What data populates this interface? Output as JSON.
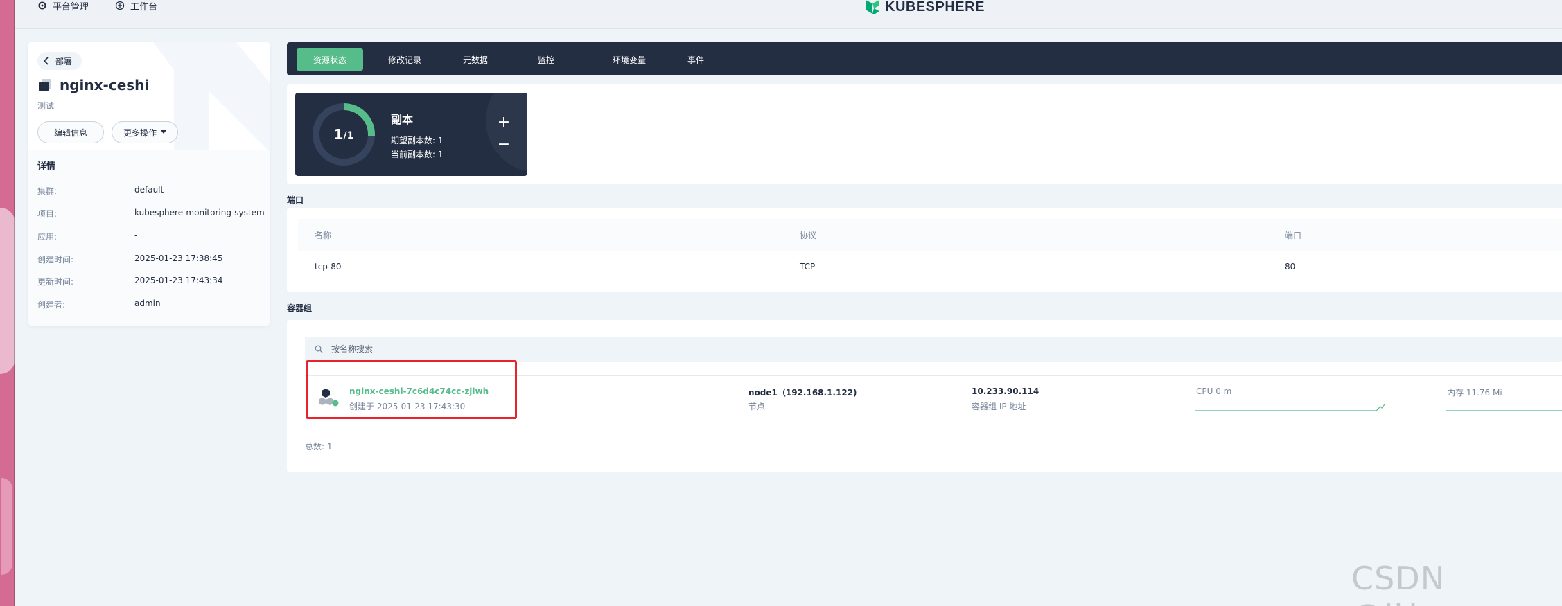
{
  "topbar": {
    "platform_label": "平台管理",
    "workbench_label": "工作台",
    "logo_text": "KUBESPHERE"
  },
  "left": {
    "back_label": "部署",
    "resource_name": "nginx-ceshi",
    "description": "测试",
    "edit_label": "编辑信息",
    "more_label": "更多操作",
    "details_title": "详情",
    "details": [
      {
        "key": "集群:",
        "value": "default"
      },
      {
        "key": "项目:",
        "value": "kubesphere-monitoring-system"
      },
      {
        "key": "应用:",
        "value": "-"
      },
      {
        "key": "创建时间:",
        "value": "2025-01-23 17:38:45"
      },
      {
        "key": "更新时间:",
        "value": "2025-01-23 17:43:34"
      },
      {
        "key": "创建者:",
        "value": "admin"
      }
    ]
  },
  "tabs": [
    "资源状态",
    "修改记录",
    "元数据",
    "监控",
    "环境变量",
    "事件"
  ],
  "replica": {
    "current": "1",
    "total": "/1",
    "ratio": 1,
    "title": "副本",
    "desired_label": "期望副本数: 1",
    "current_label": "当前副本数: 1",
    "plus": "+",
    "minus": "−"
  },
  "ports": {
    "section_title": "端口",
    "headers": [
      "名称",
      "协议",
      "端口"
    ],
    "rows": [
      {
        "name": "tcp-80",
        "protocol": "TCP",
        "port": "80"
      }
    ]
  },
  "pods": {
    "section_title": "容器组",
    "search_placeholder": "按名称搜索",
    "items": [
      {
        "name": "nginx-ceshi-7c6d4c74cc-zjlwh",
        "created": "创建于 2025-01-23 17:43:30",
        "node": "node1（192.168.1.122)",
        "node_label": "节点",
        "ip": "10.233.90.114",
        "ip_label": "容器组 IP 地址",
        "cpu": "CPU 0 m",
        "memory": "内存 11.76 Mi"
      }
    ],
    "total_label": "总数: 1"
  },
  "colors": {
    "accent": "#55bc8a",
    "dark": "#242e42",
    "highlight": "#e8232c"
  },
  "watermark": "CSDN @IUaena"
}
